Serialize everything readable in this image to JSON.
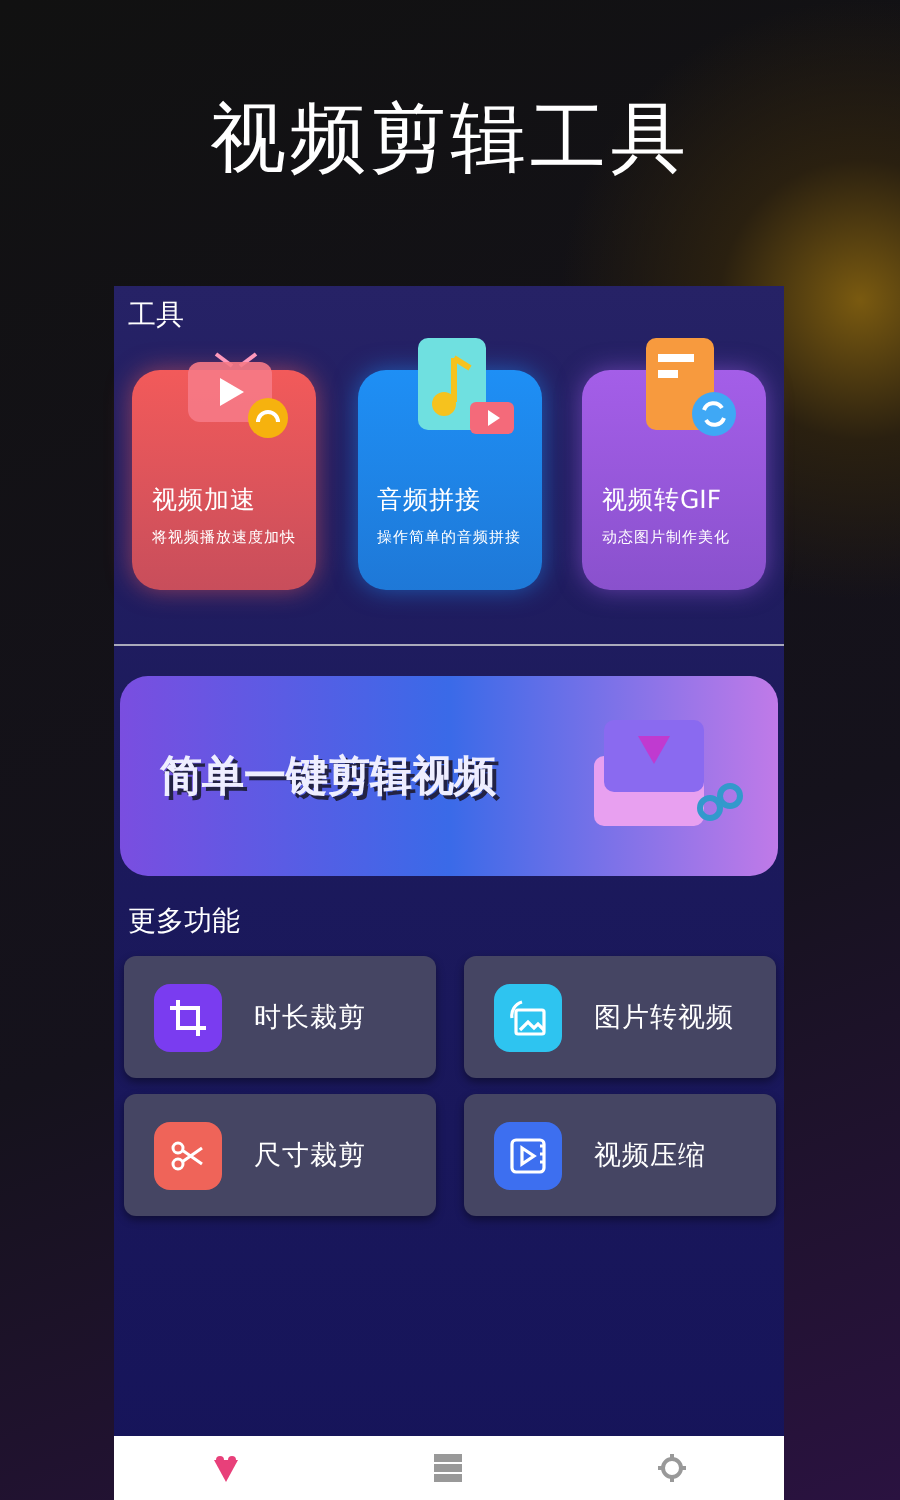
{
  "promo_title": "视频剪辑工具",
  "tools": {
    "heading": "工具",
    "items": [
      {
        "kind": "tv",
        "title": "视频加速",
        "subtitle": "将视频播放速度加快",
        "color": "#f25a5a"
      },
      {
        "kind": "music",
        "title": "音频拼接",
        "subtitle": "操作简单的音频拼接",
        "color": "#1e8ff5"
      },
      {
        "kind": "doc",
        "title": "视频转GIF",
        "subtitle": "动态图片制作美化",
        "color": "#a45ee8"
      }
    ]
  },
  "banner": {
    "text": "简单一键剪辑视频"
  },
  "more": {
    "heading": "更多功能",
    "items": [
      {
        "kind": "crop",
        "label": "时长裁剪",
        "color": "#7a3cf0"
      },
      {
        "kind": "image",
        "label": "图片转视频",
        "color": "#2ec4f0"
      },
      {
        "kind": "scissors",
        "label": "尺寸裁剪",
        "color": "#ef6459"
      },
      {
        "kind": "video",
        "label": "视频压缩",
        "color": "#3d6ff0"
      }
    ]
  },
  "nav": [
    {
      "kind": "home",
      "selected": true
    },
    {
      "kind": "list",
      "selected": false
    },
    {
      "kind": "settings",
      "selected": false
    }
  ]
}
